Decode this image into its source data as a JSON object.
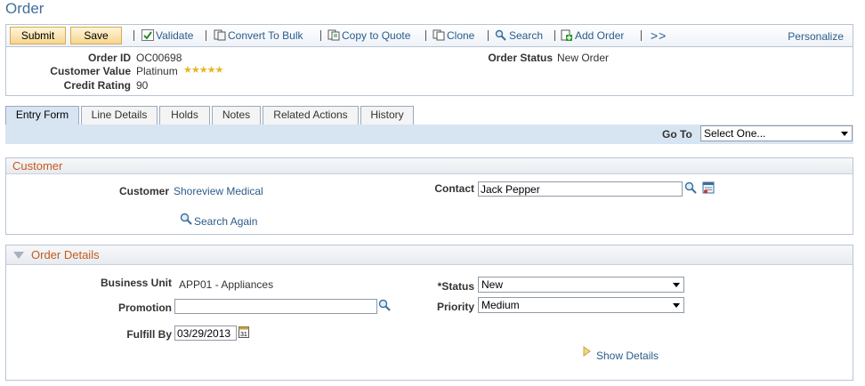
{
  "page": {
    "title": "Order"
  },
  "toolbar": {
    "submit_label": "Submit",
    "save_label": "Save",
    "validate_label": "Validate",
    "convert_label": "Convert To Bulk",
    "copy_label": "Copy to Quote",
    "clone_label": "Clone",
    "search_label": "Search",
    "add_order_label": "Add Order",
    "more_label": ">>",
    "personalize_label": "Personalize"
  },
  "header": {
    "order_id_label": "Order ID",
    "order_id": "OC00698",
    "customer_value_label": "Customer Value",
    "customer_value": "Platinum",
    "rating_stars": 5,
    "credit_rating_label": "Credit Rating",
    "credit_rating": "90",
    "order_status_label": "Order Status",
    "order_status": "New Order"
  },
  "tabs": [
    {
      "label": "Entry Form",
      "active": true
    },
    {
      "label": "Line Details",
      "active": false
    },
    {
      "label": "Holds",
      "active": false
    },
    {
      "label": "Notes",
      "active": false
    },
    {
      "label": "Related Actions",
      "active": false
    },
    {
      "label": "History",
      "active": false
    }
  ],
  "goto": {
    "label": "Go To",
    "value": "Select One..."
  },
  "customer": {
    "heading": "Customer",
    "customer_label": "Customer",
    "customer_value": "Shoreview Medical",
    "contact_label": "Contact",
    "contact_value": "Jack Pepper",
    "search_again_label": "Search Again"
  },
  "order_details": {
    "heading": "Order Details",
    "business_unit_label": "Business Unit",
    "business_unit_value": "APP01 - Appliances",
    "promotion_label": "Promotion",
    "promotion_value": "",
    "fulfill_by_label": "Fulfill By",
    "fulfill_by_value": "03/29/2013",
    "status_label": "*Status",
    "status_value": "New",
    "priority_label": "Priority",
    "priority_value": "Medium",
    "show_details_label": "Show Details"
  },
  "colors": {
    "link": "#2b5c8a",
    "section_heading": "#c45b1d",
    "tab_active": "#d7e5f3",
    "button_gold": "#f6d58f"
  }
}
